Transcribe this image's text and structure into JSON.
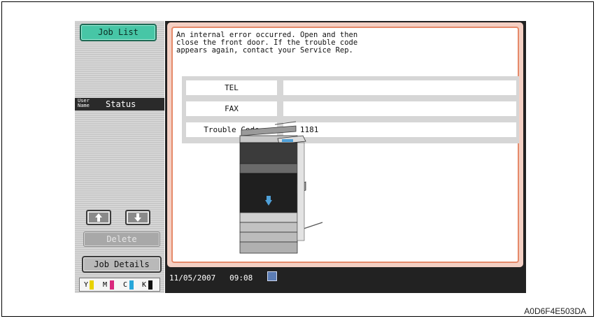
{
  "left_panel": {
    "job_list_button": "Job List",
    "user_name_header": "User Name",
    "status_header": "Status",
    "delete_button": "Delete",
    "job_details_button": "Job Details",
    "toner": [
      {
        "label": "Y",
        "color": "#e8d200"
      },
      {
        "label": "M",
        "color": "#d9277c"
      },
      {
        "label": "C",
        "color": "#27a6d9"
      },
      {
        "label": "K",
        "color": "#111111"
      }
    ]
  },
  "message": "An internal error occurred. Open and then\nclose the front door.  If the trouble code\nappears again, contact your Service Rep.",
  "info": {
    "tel_label": "TEL",
    "tel_value": "",
    "fax_label": "FAX",
    "fax_value": "",
    "trouble_code_label": "Trouble Code",
    "trouble_code_value": "C- 1181"
  },
  "status_bar": {
    "date": "11/05/2007",
    "time": "09:08",
    "network_icon": "network-icon"
  },
  "figure_code": "A0D6F4E503DA",
  "colors": {
    "job_list_accent": "#47c6a6",
    "message_frame": "#e58a6a",
    "screen_bg": "#222222"
  }
}
